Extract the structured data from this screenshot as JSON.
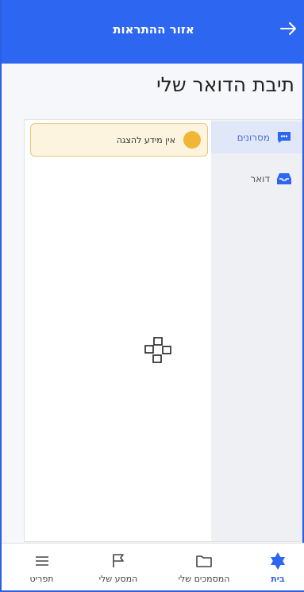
{
  "header": {
    "title": "אזור ההתראות"
  },
  "page": {
    "title": "תיבת הדואר שלי"
  },
  "sidebar": {
    "items": [
      {
        "label": "מסרונים"
      },
      {
        "label": "דואר"
      }
    ]
  },
  "notice": {
    "text": "אין מידע להצגה"
  },
  "tabbar": {
    "items": [
      {
        "label": "בית"
      },
      {
        "label": "המסמכים שלי"
      },
      {
        "label": "המסע שלי"
      },
      {
        "label": "תפריט"
      }
    ]
  },
  "colors": {
    "primary": "#2d66f0",
    "notice_bg": "#fdf4e0",
    "notice_dot": "#f2b636"
  }
}
